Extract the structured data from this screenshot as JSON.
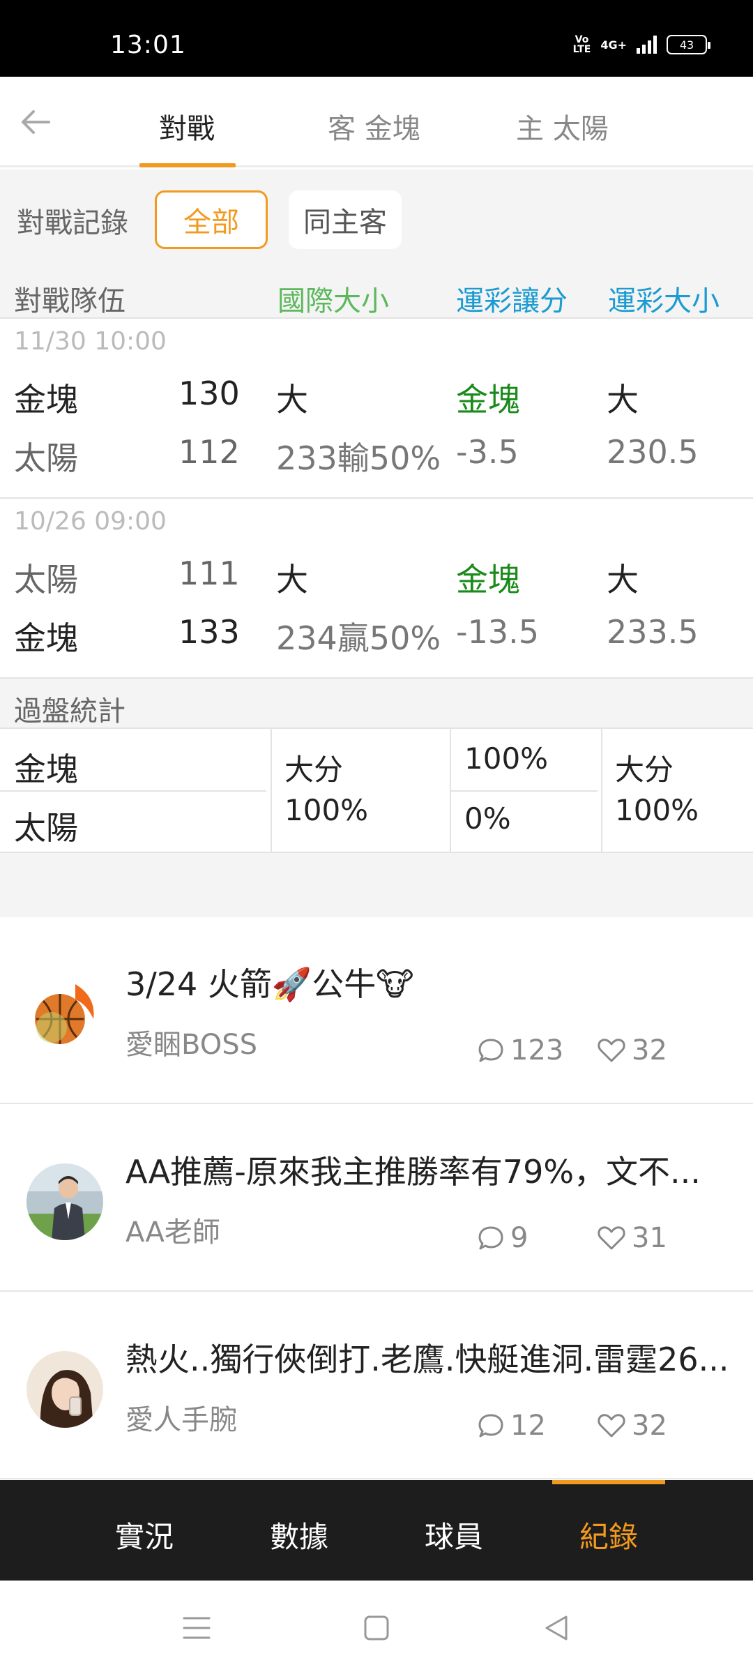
{
  "status_bar": {
    "time": "13:01",
    "volte": "Vo\nLTE",
    "network": "4G+",
    "battery": "43"
  },
  "header": {
    "back_icon": "arrow-left-icon",
    "tabs": [
      {
        "label": "對戰",
        "active": true
      },
      {
        "label": "客 金塊",
        "active": false
      },
      {
        "label": "主 太陽",
        "active": false
      }
    ]
  },
  "filter": {
    "label": "對戰記錄",
    "options": [
      {
        "label": "全部",
        "selected": true
      },
      {
        "label": "同主客",
        "selected": false
      }
    ]
  },
  "table": {
    "headers": {
      "teams": "對戰隊伍",
      "intl_ou": "國際大小",
      "spread": "運彩讓分",
      "ou": "運彩大小"
    },
    "matches": [
      {
        "date": "11/30 10:00",
        "team1": {
          "name": "金塊",
          "score": "130"
        },
        "team2": {
          "name": "太陽",
          "score": "112"
        },
        "intl_top": "大",
        "intl_bottom": "233輸50%",
        "spread_top": "金塊",
        "spread_bottom": "-3.5",
        "ou_top": "大",
        "ou_bottom": "230.5"
      },
      {
        "date": "10/26 09:00",
        "team1": {
          "name": "太陽",
          "score": "111"
        },
        "team2": {
          "name": "金塊",
          "score": "133"
        },
        "intl_top": "大",
        "intl_bottom": "234贏50%",
        "spread_top": "金塊",
        "spread_bottom": "-13.5",
        "ou_top": "大",
        "ou_bottom": "233.5"
      }
    ],
    "stats": {
      "label": "過盤統計",
      "team1": "金塊",
      "team2": "太陽",
      "intl": "大分\n100%",
      "spread_top": "100%",
      "spread_bottom": "0%",
      "ou": "大分\n100%"
    }
  },
  "posts": [
    {
      "title": "3/24 火箭🚀公牛🐮",
      "author": "愛睏BOSS",
      "comments": "123",
      "likes": "32"
    },
    {
      "title": "AA推薦-原來我主推勝率有79%，文不...",
      "author": "AA老師",
      "comments": "9",
      "likes": "31"
    },
    {
      "title": "熱火..獨行俠倒打.老鷹.快艇進洞.雷霆26...",
      "author": "愛人手腕",
      "comments": "12",
      "likes": "32"
    }
  ],
  "bottom_nav": [
    {
      "label": "實況",
      "active": false
    },
    {
      "label": "數據",
      "active": false
    },
    {
      "label": "球員",
      "active": false
    },
    {
      "label": "紀錄",
      "active": true
    }
  ],
  "colors": {
    "accent": "#f29a1f",
    "green": "#1a8a1a",
    "intl_header": "#5cb85c",
    "blue_header": "#1b9bd1"
  }
}
